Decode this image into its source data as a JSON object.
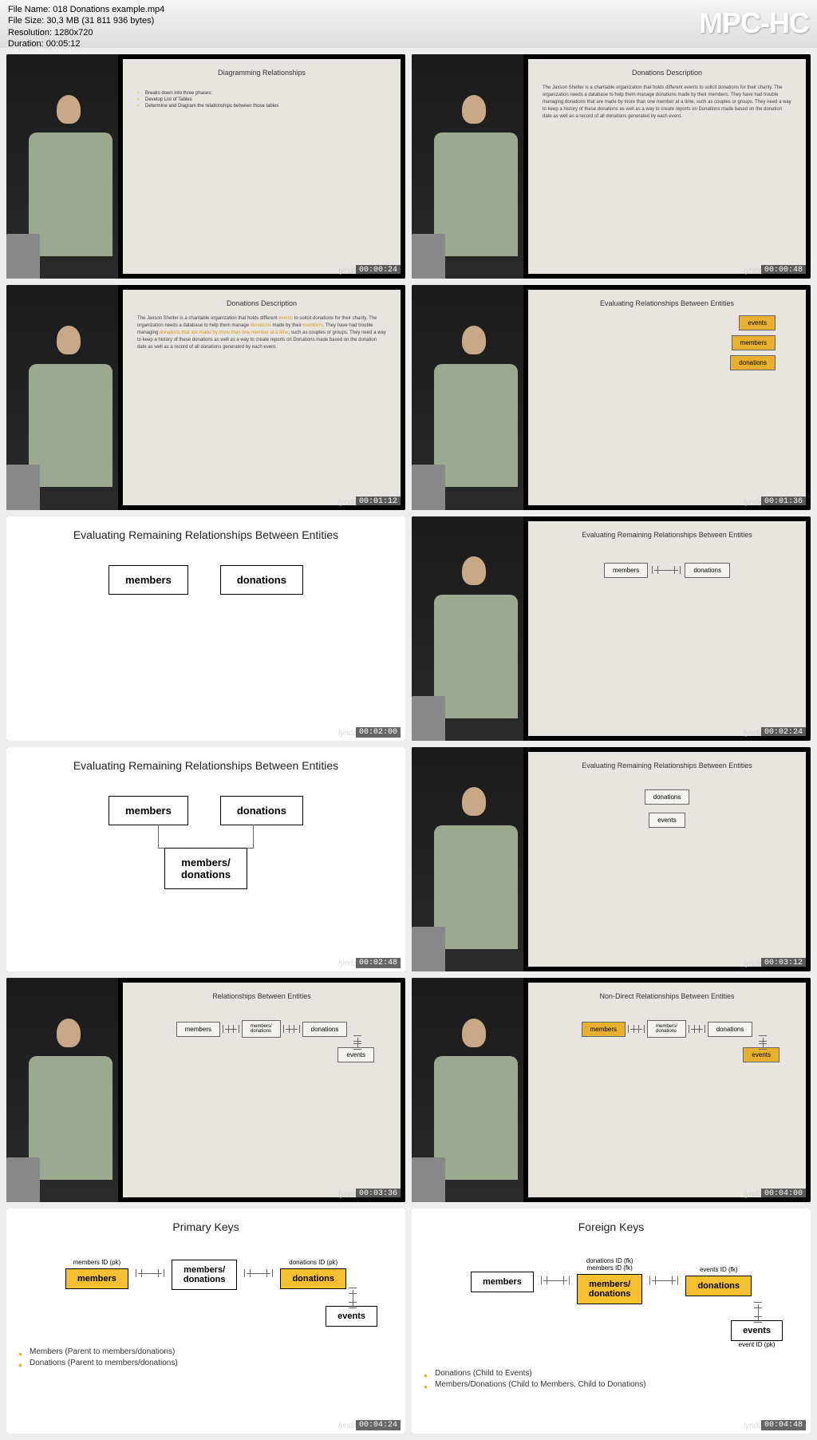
{
  "header": {
    "file_name_label": "File Name:",
    "file_name": "018 Donations example.mp4",
    "file_size_label": "File Size:",
    "file_size": "30,3 MB (31 811 936 bytes)",
    "resolution_label": "Resolution:",
    "resolution": "1280x720",
    "duration_label": "Duration:",
    "duration": "00:05:12",
    "app_name": "MPC-HC"
  },
  "watermark": "lynda",
  "thumbs": [
    {
      "timestamp": "00:00:24",
      "title": "Diagramming Relationships",
      "bullets": [
        "Breaks down into three phases:",
        "Develop List of Tables",
        "Determine and Diagram the relationships between those tables"
      ]
    },
    {
      "timestamp": "00:00:48",
      "title": "Donations Description",
      "text": "The Jaxson Shelter is a charitable organization that holds different events to solicit donations for their charity. The organization needs a database to help them manage donations made by their members. They have had trouble managing donations that are made by more than one member at a time, such as couples or groups. They need a way to keep a history of these donations as well as a way to create reports on Donations made based on the donation date as well as a record of all donations generated by each event."
    },
    {
      "timestamp": "00:01:12",
      "title": "Donations Description",
      "text_hl": "The Jaxson Shelter is a charitable organization that holds different |events| to solicit donations for their charity. The organization needs a database to help them manage |donations| made by their |members|. They have had trouble managing |donations that are made by more than one member at a time|, such as couples or groups. They need a way to keep a history of these donations as well as a way to create reports on Donations made based on the donation date as well as a record of all donations generated by each event."
    },
    {
      "timestamp": "00:01:36",
      "title": "Evaluating Relationships Between Entities",
      "boxes": [
        "events",
        "members",
        "donations"
      ]
    },
    {
      "timestamp": "00:02:00",
      "white": true,
      "title": "Evaluating Remaining Relationships Between Entities",
      "row": [
        "members",
        "donations"
      ]
    },
    {
      "timestamp": "00:02:24",
      "title": "Evaluating Remaining Relationships Between Entities",
      "row_conn": [
        "members",
        "donations"
      ]
    },
    {
      "timestamp": "00:02:48",
      "white": true,
      "title": "Evaluating Remaining Relationships Between Entities",
      "layout": "join",
      "row": [
        "members",
        "donations"
      ],
      "join": "members/\ndonations"
    },
    {
      "timestamp": "00:03:12",
      "title": "Evaluating Remaining Relationships Between Entities",
      "col": [
        "donations",
        "events"
      ]
    },
    {
      "timestamp": "00:03:36",
      "title": "Relationships Between Entities",
      "layout": "full",
      "boxes": [
        "members",
        "members/\ndonations",
        "donations",
        "events"
      ]
    },
    {
      "timestamp": "00:04:00",
      "title": "Non-Direct Relationships Between Entities",
      "layout": "full_hl",
      "hl": [
        "members",
        "events"
      ],
      "boxes": [
        "members",
        "members/\ndonations",
        "donations",
        "events"
      ]
    },
    {
      "timestamp": "00:04:24",
      "white": true,
      "title": "Primary Keys",
      "layout": "keys",
      "keys": [
        {
          "label": "members ID (pk)",
          "box": "members",
          "yellow": true
        },
        {
          "label": "",
          "box": "members/\ndonations"
        },
        {
          "label": "donations ID (pk)",
          "box": "donations",
          "yellow": true
        },
        {
          "label": "",
          "box": "events"
        }
      ],
      "bullets": [
        "Members (Parent to members/donations)",
        "Donations (Parent to members/donations)"
      ]
    },
    {
      "timestamp": "00:04:48",
      "white": true,
      "title": "Foreign Keys",
      "layout": "keys",
      "keys": [
        {
          "label": "",
          "box": "members"
        },
        {
          "label": "donations ID (fk)\nmembers ID (fk)",
          "box": "members/\ndonations",
          "yellow": true
        },
        {
          "label": "events ID (fk)",
          "box": "donations",
          "yellow": true
        },
        {
          "label": "event ID (pk)",
          "box": "events"
        }
      ],
      "bullets": [
        "Donations (Child to Events)",
        "Members/Donations (Child to Members, Child to Donations)"
      ]
    }
  ]
}
